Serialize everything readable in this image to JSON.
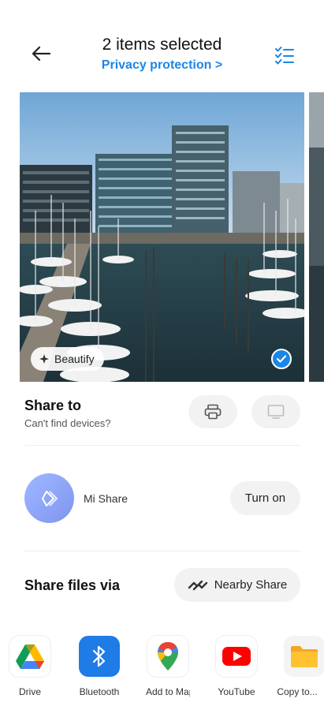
{
  "header": {
    "title": "2 items selected",
    "subtitle": "Privacy protection >",
    "back_icon": "arrow-left-icon",
    "select_all_icon": "checklist-icon"
  },
  "photo": {
    "beautify_label": "Beautify",
    "selected": true,
    "accent": "#1a86e8"
  },
  "share_to": {
    "title": "Share to",
    "subtitle": "Can't find devices?",
    "device_buttons": [
      "printer-icon",
      "tv-icon"
    ]
  },
  "mi_share": {
    "label": "Mi Share",
    "button": "Turn on"
  },
  "share_files_via": {
    "title": "Share files via",
    "nearby_label": "Nearby Share"
  },
  "apps": [
    {
      "label": "Drive",
      "icon": "google-drive-icon"
    },
    {
      "label": "Bluetooth",
      "icon": "bluetooth-icon"
    },
    {
      "label": "Add to Maps",
      "icon": "google-maps-icon"
    },
    {
      "label": "YouTube",
      "icon": "youtube-icon"
    },
    {
      "label": "Copy to...",
      "icon": "folder-icon"
    }
  ]
}
